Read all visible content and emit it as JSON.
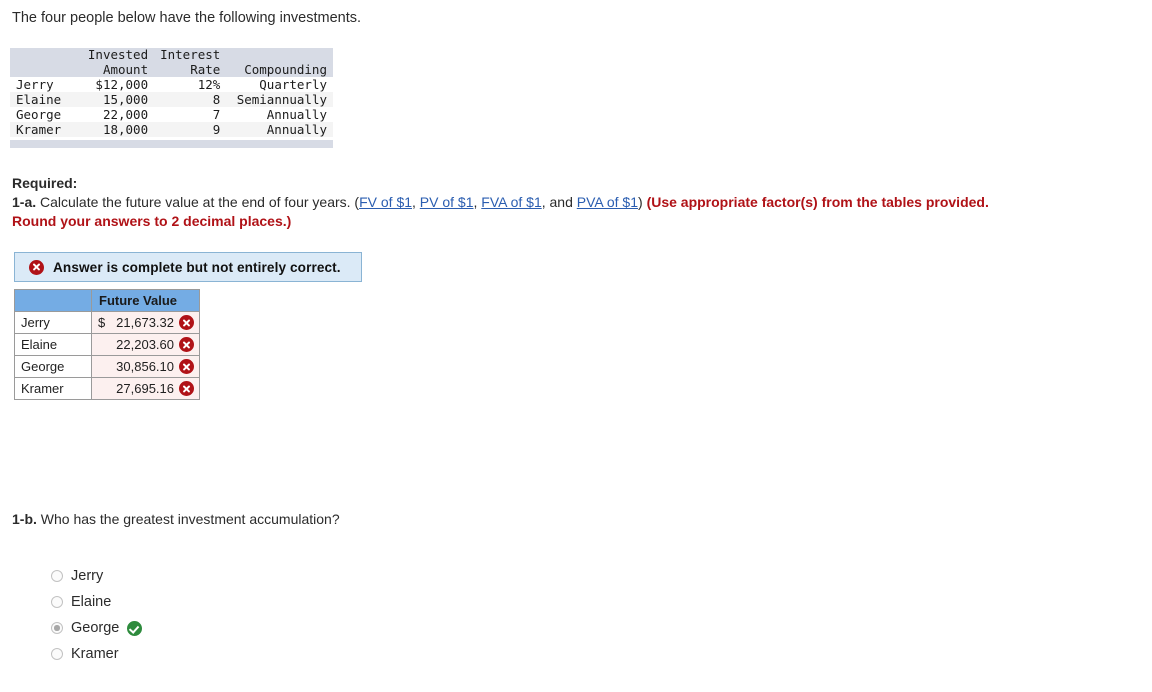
{
  "intro": "The four people below have the following investments.",
  "investments_table": {
    "headers": {
      "name": "",
      "amount_line1": "Invested",
      "amount_line2": "Amount",
      "rate_line1": "Interest",
      "rate_line2": "Rate",
      "compounding_line1": "",
      "compounding_line2": "Compounding"
    },
    "rows": [
      {
        "name": "Jerry",
        "amount": "$12,000",
        "rate": "12%",
        "compounding": "Quarterly"
      },
      {
        "name": "Elaine",
        "amount": "15,000",
        "rate": "8",
        "compounding": "Semiannually"
      },
      {
        "name": "George",
        "amount": "22,000",
        "rate": "7",
        "compounding": "Annually"
      },
      {
        "name": "Kramer",
        "amount": "18,000",
        "rate": "9",
        "compounding": "Annually"
      }
    ]
  },
  "required": {
    "label": "Required:",
    "q1a_num": "1-a.",
    "q1a_text": " Calculate the future value at the end of four years. (",
    "links": [
      {
        "text": "FV of $1"
      },
      {
        "text": "PV of $1"
      },
      {
        "text": "FVA of $1"
      },
      {
        "text": "PVA of $1"
      }
    ],
    "sep_comma": ", ",
    "sep_and": ", and ",
    "close_paren": ") ",
    "instruction_bold": "(Use appropriate factor(s) from the tables provided. Round your answers to 2 decimal places.)"
  },
  "status_banner": {
    "icon": "circle-x-icon",
    "text": "Answer is complete but not entirely correct.",
    "background_color": "#dbeaf7",
    "border_color": "#8ab4d4",
    "icon_color": "#b01217"
  },
  "answer_table": {
    "header_blank": "",
    "header_future_value": "Future Value",
    "header_color": "#74ace4",
    "cell_color": "#fcf0ef",
    "rows": [
      {
        "name": "Jerry",
        "currency": "$",
        "value": "21,673.32",
        "status": "incorrect"
      },
      {
        "name": "Elaine",
        "currency": "",
        "value": "22,203.60",
        "status": "incorrect"
      },
      {
        "name": "George",
        "currency": "",
        "value": "30,856.10",
        "status": "incorrect"
      },
      {
        "name": "Kramer",
        "currency": "",
        "value": "27,695.16",
        "status": "incorrect"
      }
    ]
  },
  "question_b": {
    "num": "1-b.",
    "text": " Who has the greatest investment accumulation?",
    "options": [
      {
        "label": "Jerry",
        "selected": false,
        "status": ""
      },
      {
        "label": "Elaine",
        "selected": false,
        "status": ""
      },
      {
        "label": "George",
        "selected": true,
        "status": "correct"
      },
      {
        "label": "Kramer",
        "selected": false,
        "status": ""
      }
    ]
  }
}
